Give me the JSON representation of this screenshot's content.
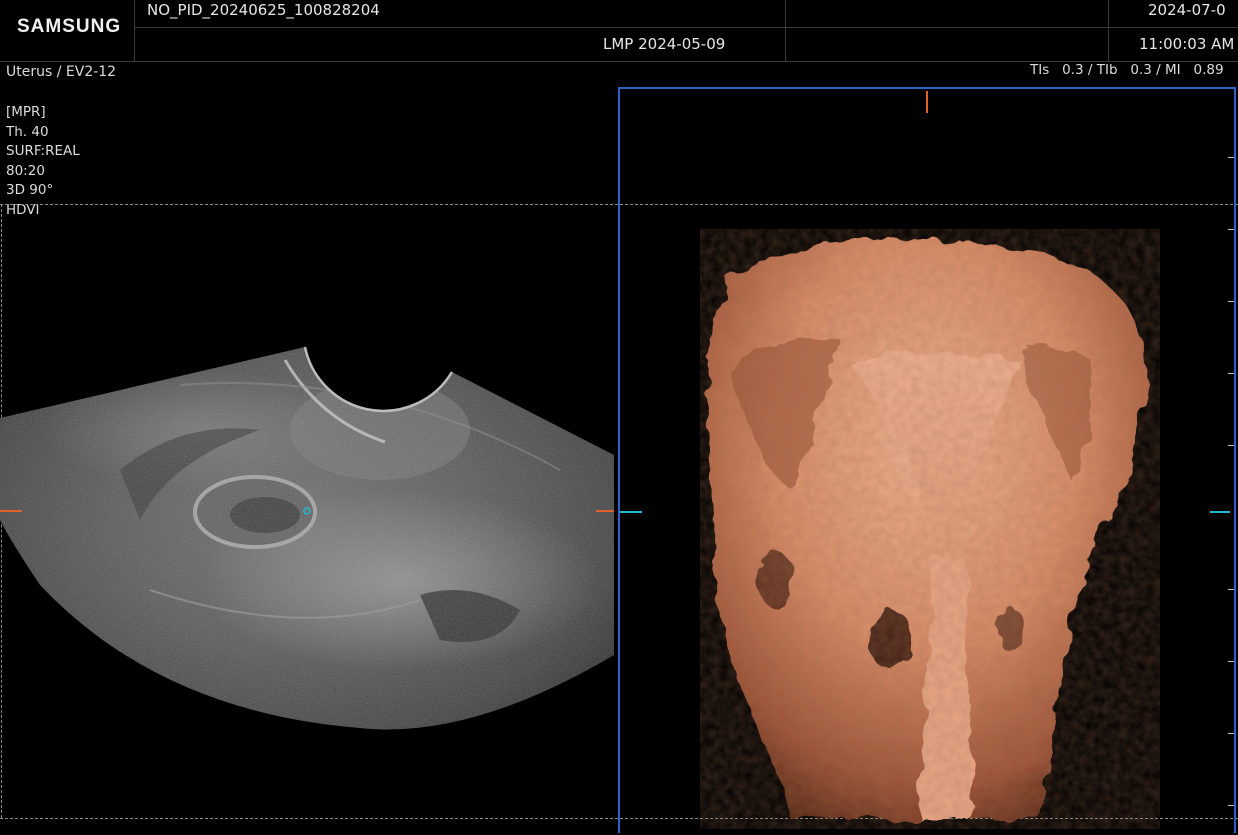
{
  "header": {
    "brand": "SAMSUNG",
    "patient_id": "NO_PID_20240625_100828204",
    "lmp": "LMP 2024-05-09",
    "date": "2024-07-0",
    "time": "11:00:03 AM"
  },
  "probe": {
    "preset": "Uterus / EV2-12",
    "safety": "TIs   0.3 / TIb   0.3 / MI   0.89"
  },
  "params": {
    "mode": "[MPR]",
    "thickness": "Th. 40",
    "surface": "SURF:REAL",
    "ratio": "80:20",
    "angle": "3D 90°",
    "render": "HDVI"
  },
  "colors": {
    "frame_accent": "#2b62c9",
    "marker_orange": "#e0622a",
    "marker_cyan": "#25b8d0",
    "render_skin": "#d98e6a"
  }
}
